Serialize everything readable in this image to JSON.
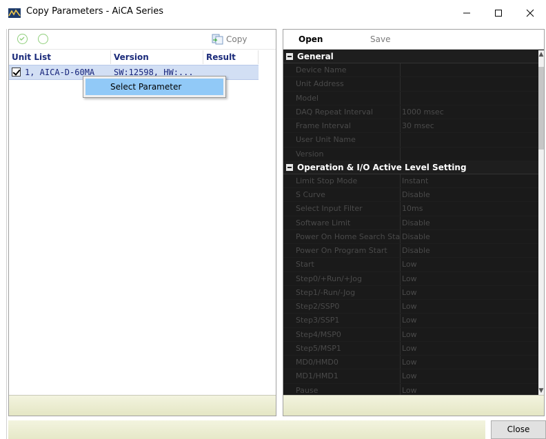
{
  "window": {
    "title": "Copy Parameters - AiCA Series",
    "minimize_label": "—",
    "maximize_label": "☐",
    "close_label": "✕"
  },
  "left_toolbar": {
    "copy_label": "Copy"
  },
  "unit_grid": {
    "columns": [
      "Unit List",
      "Version",
      "Result"
    ],
    "rows": [
      {
        "checked": true,
        "unit": "1, AICA-D-60MA",
        "version": "SW:12598, HW:...",
        "result": ""
      }
    ]
  },
  "context_menu": {
    "items": [
      "Select Parameter"
    ]
  },
  "right_toolbar": {
    "open_label": "Open",
    "save_label": "Save"
  },
  "property_grid": {
    "categories": [
      {
        "name": "General",
        "props": [
          {
            "name": "Device Name",
            "value": ""
          },
          {
            "name": "Unit Address",
            "value": ""
          },
          {
            "name": "Model",
            "value": ""
          },
          {
            "name": "DAQ Repeat Interval",
            "value": "1000 msec"
          },
          {
            "name": "Frame Interval",
            "value": "30 msec"
          },
          {
            "name": "User Unit Name",
            "value": ""
          },
          {
            "name": "Version",
            "value": ""
          }
        ]
      },
      {
        "name": "Operation & I/O Active Level Setting",
        "props": [
          {
            "name": "Limit Stop Mode",
            "value": "Instant"
          },
          {
            "name": "S Curve",
            "value": "Disable"
          },
          {
            "name": "Select Input Filter",
            "value": "10ms"
          },
          {
            "name": "Software Limit",
            "value": "Disable"
          },
          {
            "name": "Power On Home Search Sta",
            "value": "Disable"
          },
          {
            "name": "Power On Program Start",
            "value": "Disable"
          },
          {
            "name": "Start",
            "value": "Low"
          },
          {
            "name": "Step0/+Run/+Jog",
            "value": "Low"
          },
          {
            "name": "Step1/-Run/-Jog",
            "value": "Low"
          },
          {
            "name": "Step2/SSP0",
            "value": "Low"
          },
          {
            "name": "Step3/SSP1",
            "value": "Low"
          },
          {
            "name": "Step4/MSP0",
            "value": "Low"
          },
          {
            "name": "Step5/MSP1",
            "value": "Low"
          },
          {
            "name": "MD0/HMD0",
            "value": "Low"
          },
          {
            "name": "MD1/HMD1",
            "value": "Low"
          },
          {
            "name": "Pause",
            "value": "Low"
          }
        ]
      }
    ]
  },
  "footer": {
    "close_label": "Close"
  },
  "colors": {
    "selection": "#d2dff4",
    "menu_highlight": "#91c9f7",
    "grid_background": "#1a1a1a",
    "status_bar": "#e4e6c4",
    "header_text": "#1a2a7a"
  }
}
